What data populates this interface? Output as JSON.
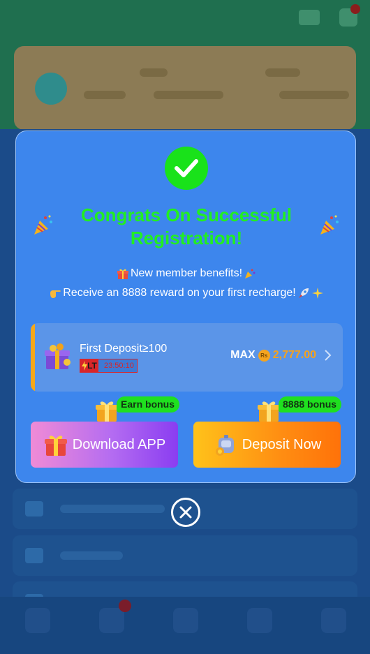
{
  "modal": {
    "title": "Congrats On Successful Registration!",
    "benefits": {
      "line1": "New member benefits!",
      "line2": "Receive an 8888 reward on your first recharge!"
    },
    "deposit_offer": {
      "title": "First Deposit≥100",
      "timer_badge": "LT",
      "timer": "23:50:10",
      "max_label": "MAX",
      "currency_symbol": "Rs",
      "amount": "2,777.00"
    },
    "download_button": {
      "tag": "Earn bonus",
      "label": "Download APP"
    },
    "deposit_button": {
      "tag": "8888 bonus",
      "label": "Deposit Now"
    }
  },
  "colors": {
    "modal_bg": "#3d86ed",
    "title_green": "#22ee22",
    "amount_orange": "#f6a21c",
    "bonus_tag_green": "#1fe01f"
  },
  "icons": {
    "check": "check-circle-icon",
    "party": "party-popper-icon",
    "gift": "gift-icon",
    "close": "close-circle-icon"
  }
}
